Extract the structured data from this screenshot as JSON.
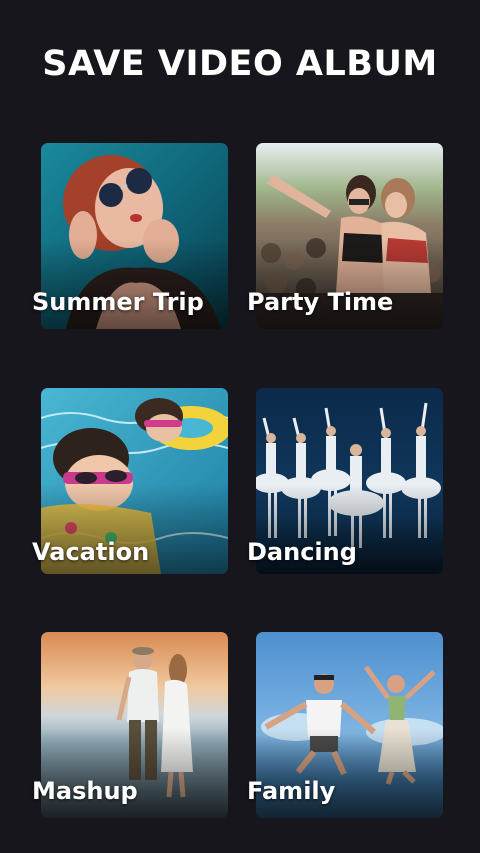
{
  "header": {
    "title": "SAVE VIDEO ALBUM"
  },
  "albums": [
    {
      "label": "Summer Trip",
      "photo": "woman-sunglasses-photo"
    },
    {
      "label": "Party Time",
      "photo": "concert-crowd-photo"
    },
    {
      "label": "Vacation",
      "photo": "kids-pool-photo"
    },
    {
      "label": "Dancing",
      "photo": "ballet-dancers-photo"
    },
    {
      "label": "Mashup",
      "photo": "beach-couple-photo"
    },
    {
      "label": "Family",
      "photo": "jumping-couple-photo"
    }
  ],
  "colors": {
    "background": "#16161c",
    "text": "#ffffff"
  }
}
